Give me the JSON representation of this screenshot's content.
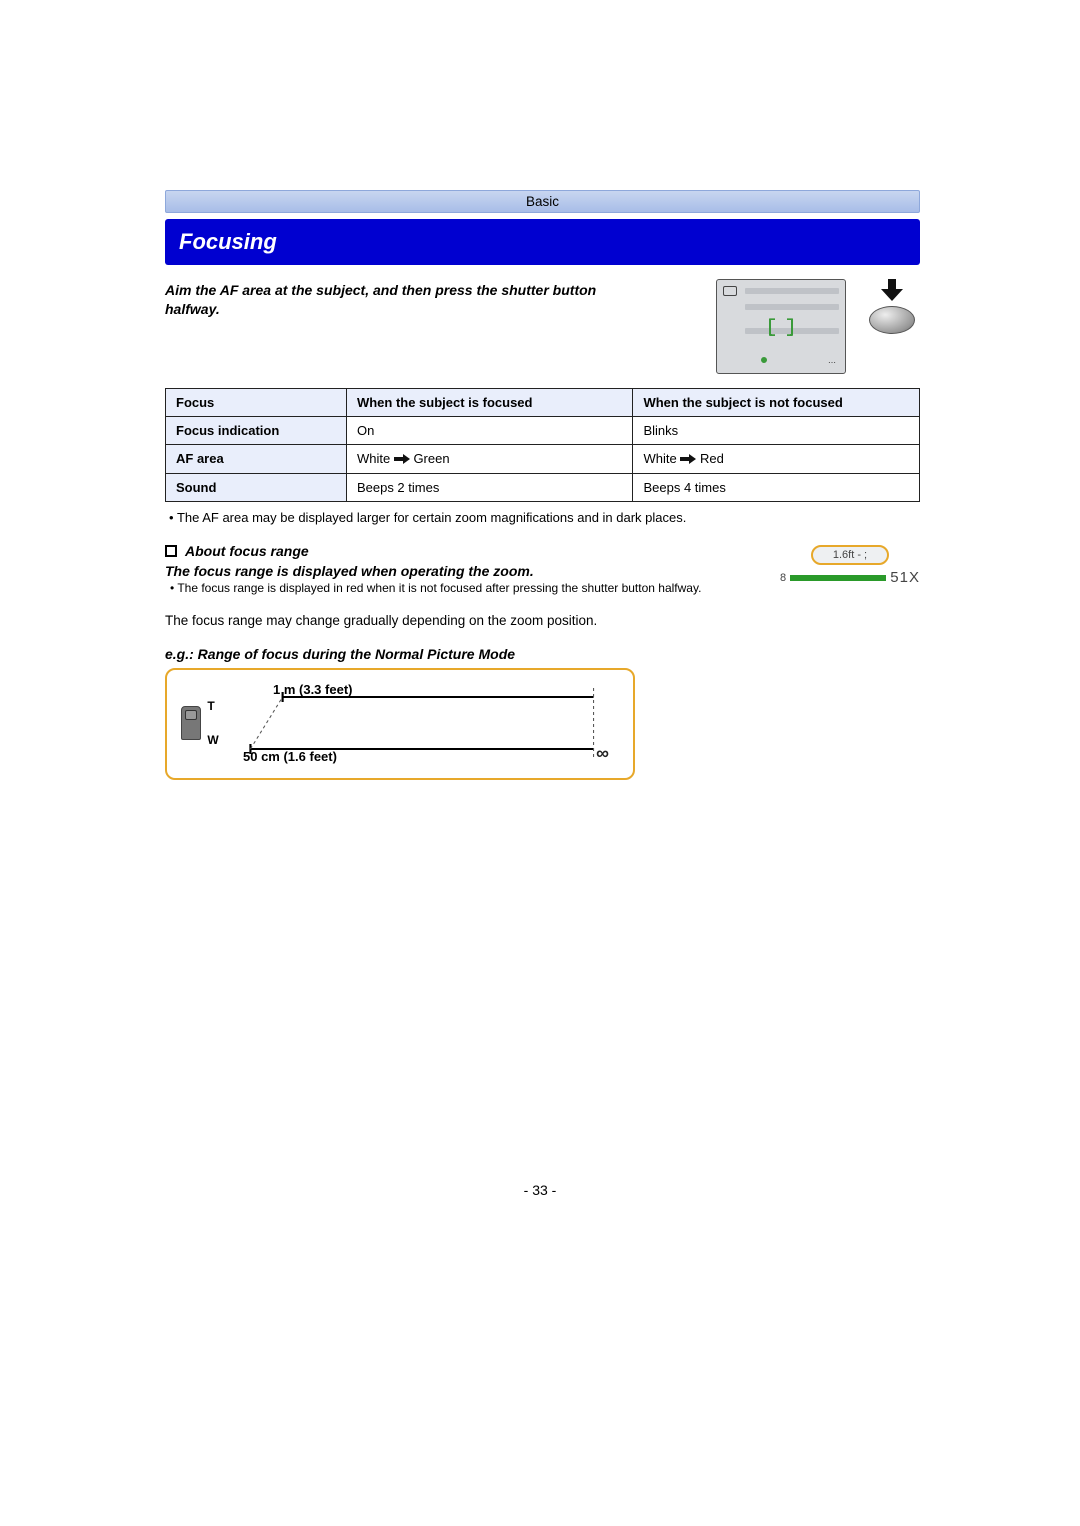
{
  "section": "Basic",
  "title": "Focusing",
  "intro_line1": "Aim the AF area at the subject, and then press the shutter button",
  "intro_line2": "halfway.",
  "table": {
    "headers": [
      "Focus",
      "When the subject is focused",
      "When the subject is not focused"
    ],
    "rows": [
      {
        "label": "Focus indication",
        "c1": "On",
        "c2": "Blinks"
      },
      {
        "label": "AF area",
        "c1a": "White",
        "c1b": "Green",
        "c2a": "White",
        "c2b": "Red"
      },
      {
        "label": "Sound",
        "c1": "Beeps 2 times",
        "c2": "Beeps 4 times"
      }
    ]
  },
  "note_after_table": "The AF area may be displayed larger for certain zoom magnifications and in dark places.",
  "about_heading": "About focus range",
  "about_body": "The focus range is displayed when operating the zoom.",
  "about_bullet": "The focus range is displayed in red when it is not focused after pressing the shutter button halfway.",
  "gradual_para": "The focus range may change gradually depending on the zoom position.",
  "range_badge": "1.6ft -  ;",
  "range_left": "8",
  "range_zoom": "51X",
  "eg_title": "e.g.: Range of focus during the Normal Picture Mode",
  "eg_top_label": "1 m (3.3 feet)",
  "eg_bottom_label": "50 cm (1.6 feet)",
  "eg_infinity": "∞",
  "eg_T": "T",
  "eg_W": "W",
  "page_number": "- 33 -"
}
